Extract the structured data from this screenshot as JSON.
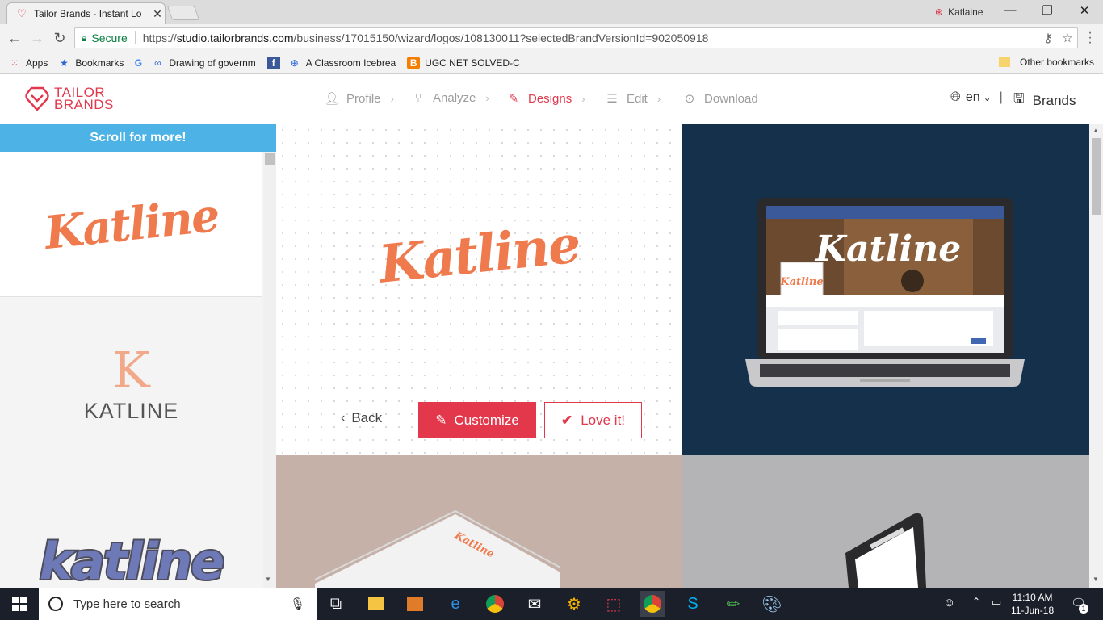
{
  "browser": {
    "tab_title": "Tailor Brands - Instant Lo",
    "profile_name": "Katlaine",
    "secure_label": "Secure",
    "url_prefix": "https://",
    "url_domain": "studio.tailorbrands.com",
    "url_path": "/business/17015150/wizard/logos/108130011?selectedBrandVersionId=902050918"
  },
  "bookmarks": {
    "items": [
      "Apps",
      "Bookmarks",
      "Drawing of governm",
      "A Classroom Icebrea",
      "UGC NET SOLVED-C"
    ],
    "other": "Other bookmarks"
  },
  "site": {
    "logo_line1": "TAILOR",
    "logo_line2": "BRANDS",
    "steps": [
      "Profile",
      "Analyze",
      "Designs",
      "Edit",
      "Download"
    ],
    "active_step": "Designs",
    "lang": "en",
    "brands": "Brands"
  },
  "sidebar": {
    "banner": "Scroll for more!",
    "thumb1": "Katline",
    "thumb2_mono": "K",
    "thumb2_word": "KATLINE",
    "thumb3": "katline"
  },
  "main": {
    "logo_text": "Katline",
    "back": "Back",
    "customize": "Customize",
    "love": "Love it!"
  },
  "taskbar": {
    "search_placeholder": "Type here to search",
    "time": "11:10 AM",
    "date": "11-Jun-18",
    "notification_count": "1"
  },
  "colors": {
    "brand_red": "#e3384c",
    "logo_orange": "#ef7a4d",
    "banner_blue": "#4db3e6",
    "laptop_bg": "#14304a"
  }
}
